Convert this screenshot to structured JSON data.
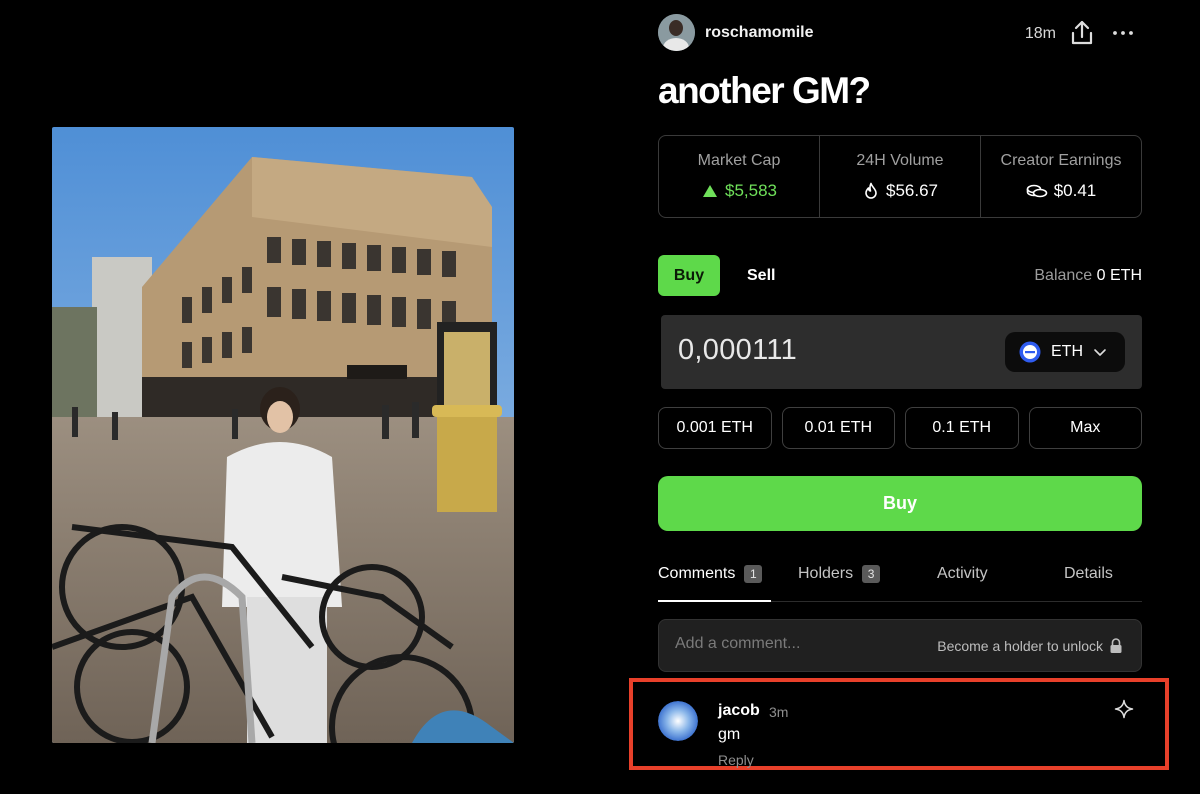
{
  "post": {
    "username": "roschamomile",
    "time_ago": "18m",
    "title": "another GM?"
  },
  "stats": [
    {
      "label": "Market Cap",
      "value": "$5,583",
      "icon": "triangle-up-icon",
      "color": "#6fe05a"
    },
    {
      "label": "24H Volume",
      "value": "$56.67",
      "icon": "flame-icon"
    },
    {
      "label": "Creator Earnings",
      "value": "$0.41",
      "icon": "coins-icon"
    }
  ],
  "trade": {
    "buy_tab": "Buy",
    "sell_tab": "Sell",
    "balance_label": "Balance",
    "balance_value": "0 ETH",
    "amount": "0,000111",
    "token": "ETH",
    "presets": [
      "0.001 ETH",
      "0.01 ETH",
      "0.1 ETH",
      "Max"
    ],
    "buy_button": "Buy"
  },
  "tabs": [
    {
      "label": "Comments",
      "count": "1"
    },
    {
      "label": "Holders",
      "count": "3"
    },
    {
      "label": "Activity"
    },
    {
      "label": "Details"
    }
  ],
  "comment_input": {
    "placeholder": "Add a comment...",
    "unlock_text": "Become a holder to unlock"
  },
  "comments": [
    {
      "user": "jacob",
      "time": "3m",
      "text": "gm",
      "reply": "Reply"
    }
  ],
  "colors": {
    "accent_green": "#5ed94a",
    "highlight_border": "#e8402a",
    "background": "#000000"
  }
}
